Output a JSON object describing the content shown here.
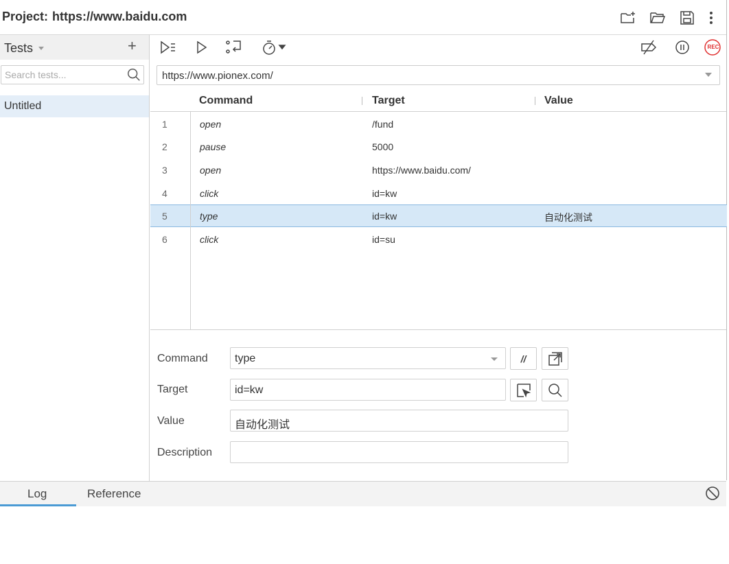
{
  "header": {
    "project_label": "Project:",
    "project_name": "https://www.baidu.com",
    "icons": [
      "new-folder-icon",
      "open-folder-icon",
      "save-icon",
      "more-vertical-icon"
    ]
  },
  "sidebar": {
    "title": "Tests",
    "add_label": "+",
    "search_placeholder": "Search tests...",
    "tests": [
      {
        "name": "Untitled",
        "selected": true
      }
    ]
  },
  "toolbar": {
    "icons": [
      "run-all-tests-icon",
      "run-current-test-icon",
      "step-over-icon",
      "speed-timer-icon",
      "disable-breakpoints-icon",
      "pause-icon",
      "record-icon"
    ],
    "record_label": "REC"
  },
  "base_url": "https://www.pionex.com/",
  "table": {
    "headers": {
      "command": "Command",
      "target": "Target",
      "value": "Value"
    },
    "rows": [
      {
        "num": "1",
        "command": "open",
        "target": "/fund",
        "value": ""
      },
      {
        "num": "2",
        "command": "pause",
        "target": "5000",
        "value": ""
      },
      {
        "num": "3",
        "command": "open",
        "target": "https://www.baidu.com/",
        "value": ""
      },
      {
        "num": "4",
        "command": "click",
        "target": "id=kw",
        "value": ""
      },
      {
        "num": "5",
        "command": "type",
        "target": "id=kw",
        "value": "自动化测试",
        "selected": true
      },
      {
        "num": "6",
        "command": "click",
        "target": "id=su",
        "value": ""
      }
    ]
  },
  "editor": {
    "command_label": "Command",
    "command_value": "type",
    "comment_button": "//",
    "target_label": "Target",
    "target_value": "id=kw",
    "value_label": "Value",
    "value_value": "自动化测试",
    "description_label": "Description",
    "description_value": ""
  },
  "bottom": {
    "tabs": [
      {
        "label": "Log",
        "active": true
      },
      {
        "label": "Reference",
        "active": false
      }
    ]
  },
  "colors": {
    "selected_row": "#d6e8f7",
    "record_red": "#e03030",
    "active_tab_underline": "#4a9ad4"
  }
}
